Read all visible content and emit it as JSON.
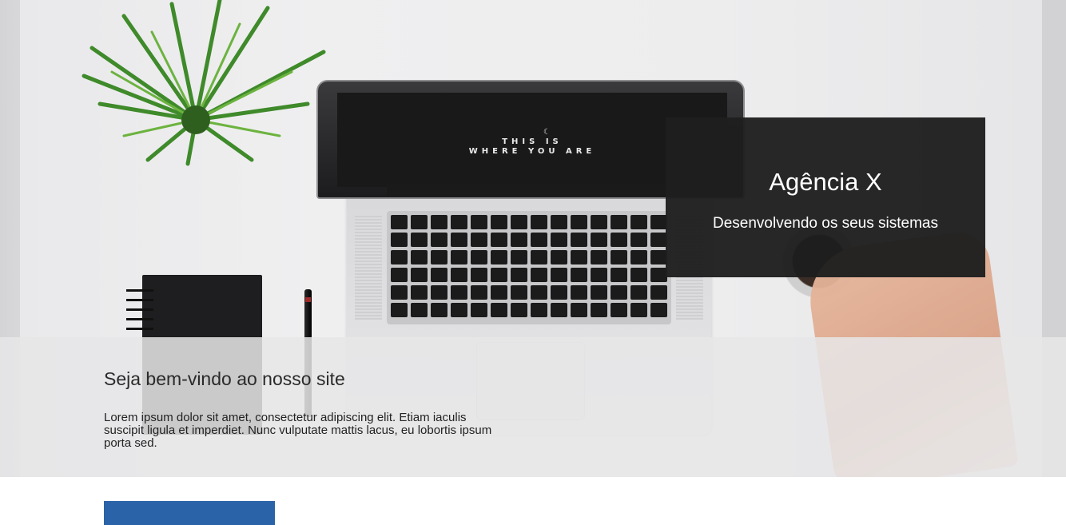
{
  "hero": {
    "laptop_screen_line1": "THIS IS",
    "laptop_screen_line2": "WHERE YOU ARE"
  },
  "brand": {
    "title": "Agência X",
    "subtitle": "Desenvolvendo os seus sistemas"
  },
  "welcome": {
    "title": "Seja bem-vindo ao nosso site",
    "text": "Lorem ipsum dolor sit amet, consectetur adipiscing elit. Etiam iaculis suscipit ligula et imperdiet. Nunc vulputate mattis lacus, eu lobortis ipsum porta sed."
  },
  "cta": {
    "label": ""
  },
  "colors": {
    "brand_box_bg": "#1e1e1e",
    "cta_bg": "#2a63a8"
  }
}
